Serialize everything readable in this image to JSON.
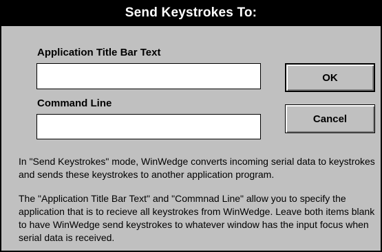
{
  "dialog": {
    "title": "Send Keystrokes To:"
  },
  "fields": {
    "title_bar_text": {
      "label": "Application Title Bar Text",
      "value": ""
    },
    "command_line": {
      "label": "Command Line",
      "value": ""
    }
  },
  "buttons": {
    "ok": "OK",
    "cancel": "Cancel"
  },
  "help": {
    "paragraph1": "In \"Send Keystrokes\" mode, WinWedge converts incoming serial data to keystrokes and sends these keystrokes to another application program.",
    "paragraph2": "The \"Application Title Bar Text\" and \"Commnad Line\" allow you to specify the application that is to recieve all keystrokes from WinWedge. Leave both items blank to have WinWedge send keystrokes to whatever window has the input focus when serial data is received."
  }
}
